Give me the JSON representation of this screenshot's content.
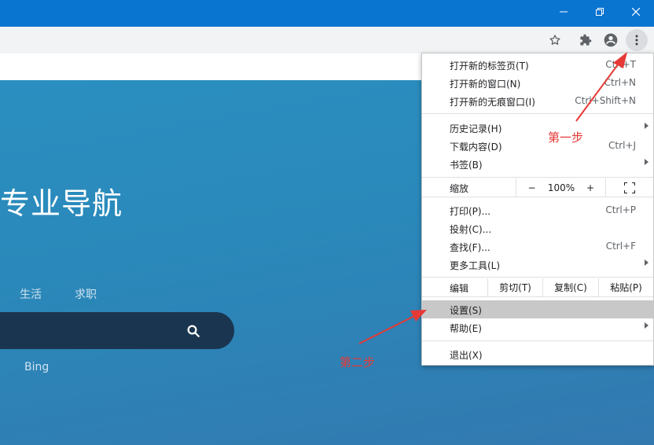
{
  "window": {
    "controls": {
      "minimize": "minimize",
      "restore": "restore",
      "close": "close"
    }
  },
  "toolbar": {
    "icons": [
      "star-icon",
      "extensions-icon",
      "profile-icon",
      "menu-icon"
    ]
  },
  "page": {
    "title": "专业导航",
    "tabs": [
      "生活",
      "求职"
    ],
    "search": {
      "placeholder": ""
    },
    "engines": [
      "Bing"
    ]
  },
  "menu": {
    "new_tab": {
      "label": "打开新的标签页(T)",
      "shortcut": "Ctrl+T"
    },
    "new_window": {
      "label": "打开新的窗口(N)",
      "shortcut": "Ctrl+N"
    },
    "incognito": {
      "label": "打开新的无痕窗口(I)",
      "shortcut": "Ctrl+Shift+N"
    },
    "history": {
      "label": "历史记录(H)"
    },
    "downloads": {
      "label": "下载内容(D)",
      "shortcut": "Ctrl+J"
    },
    "bookmarks": {
      "label": "书签(B)"
    },
    "zoom": {
      "label": "缩放",
      "minus": "−",
      "value": "100%",
      "plus": "+"
    },
    "print": {
      "label": "打印(P)...",
      "shortcut": "Ctrl+P"
    },
    "cast": {
      "label": "投射(C)..."
    },
    "find": {
      "label": "查找(F)...",
      "shortcut": "Ctrl+F"
    },
    "more_tools": {
      "label": "更多工具(L)"
    },
    "edit": {
      "label": "编辑",
      "cut": "剪切(T)",
      "copy": "复制(C)",
      "paste": "粘贴(P)"
    },
    "settings": {
      "label": "设置(S)"
    },
    "help": {
      "label": "帮助(E)"
    },
    "exit": {
      "label": "退出(X)"
    }
  },
  "annotations": {
    "step1": "第一步",
    "step2": "第二步"
  },
  "colors": {
    "titlebar": "#0a74d1",
    "annotation": "#e53935",
    "highlight": "#c8c8c8"
  }
}
